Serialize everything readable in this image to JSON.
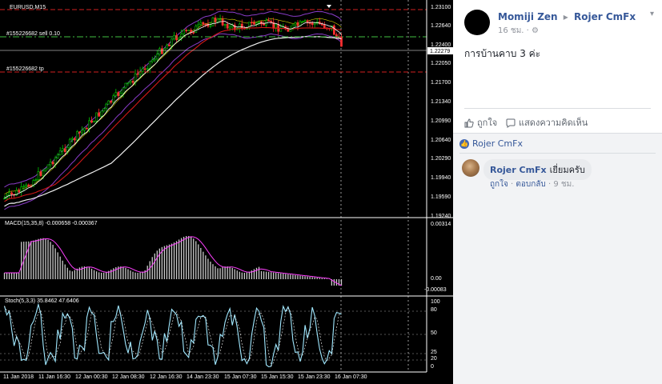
{
  "chart": {
    "price_panel_label": "EURUSD,M15",
    "order_lines": {
      "sell": "#155226682 sell 0.10",
      "tp": "#155226682 tp"
    },
    "price_axis": [
      "1.23100",
      "1.22640",
      "1.22400",
      "1.22050",
      "1.21700",
      "1.21340",
      "1.20990",
      "1.20640",
      "1.20290",
      "1.19940",
      "1.19590",
      "1.19240"
    ],
    "current_price": "1.22279",
    "macd_label": "MACD(15,35,8) -0.000658 -0.000367",
    "macd_axis": [
      "0.00314",
      "0.00",
      "-0.00083"
    ],
    "stoch_label": "Stoch(5,3,3) 35.8462 47.6406",
    "stoch_axis": [
      "100",
      "80",
      "50",
      "25",
      "20",
      "0"
    ],
    "time_axis": [
      "11 Jan 2018",
      "11 Jan 16:30",
      "12 Jan 00:30",
      "12 Jan 08:30",
      "12 Jan 16:30",
      "14 Jan 23:30",
      "15 Jan 07:30",
      "15 Jan 15:30",
      "15 Jan 23:30",
      "16 Jan 07:30"
    ],
    "colors": {
      "background": "#000000",
      "candle_up": "#00c800",
      "candle_down": "#ff3030",
      "ma_red": "#d01818",
      "ma_white": "#f0f0f0",
      "envelope_purple": "#8a3cc8",
      "envelope_yellow": "#d8d800",
      "order_line": "#d02020",
      "sell_line": "#40c040",
      "stoch_main": "#a0e8ff",
      "macd_signal": "#ff40ff"
    }
  },
  "post": {
    "author": "Momiji Zen",
    "target": "Rojer CmFx",
    "time": "16 ชม.",
    "text": "การบ้านคาบ 3 ค่ะ",
    "actions": {
      "like": "ถูกใจ",
      "comment": "แสดงความคิดเห็น"
    },
    "liked_by": "Rojer CmFx",
    "comment": {
      "author": "Rojer CmFx",
      "text": "เยี่ยมครับ",
      "like": "ถูกใจ",
      "reply": "ตอบกลับ",
      "time": "9 ชม."
    }
  }
}
